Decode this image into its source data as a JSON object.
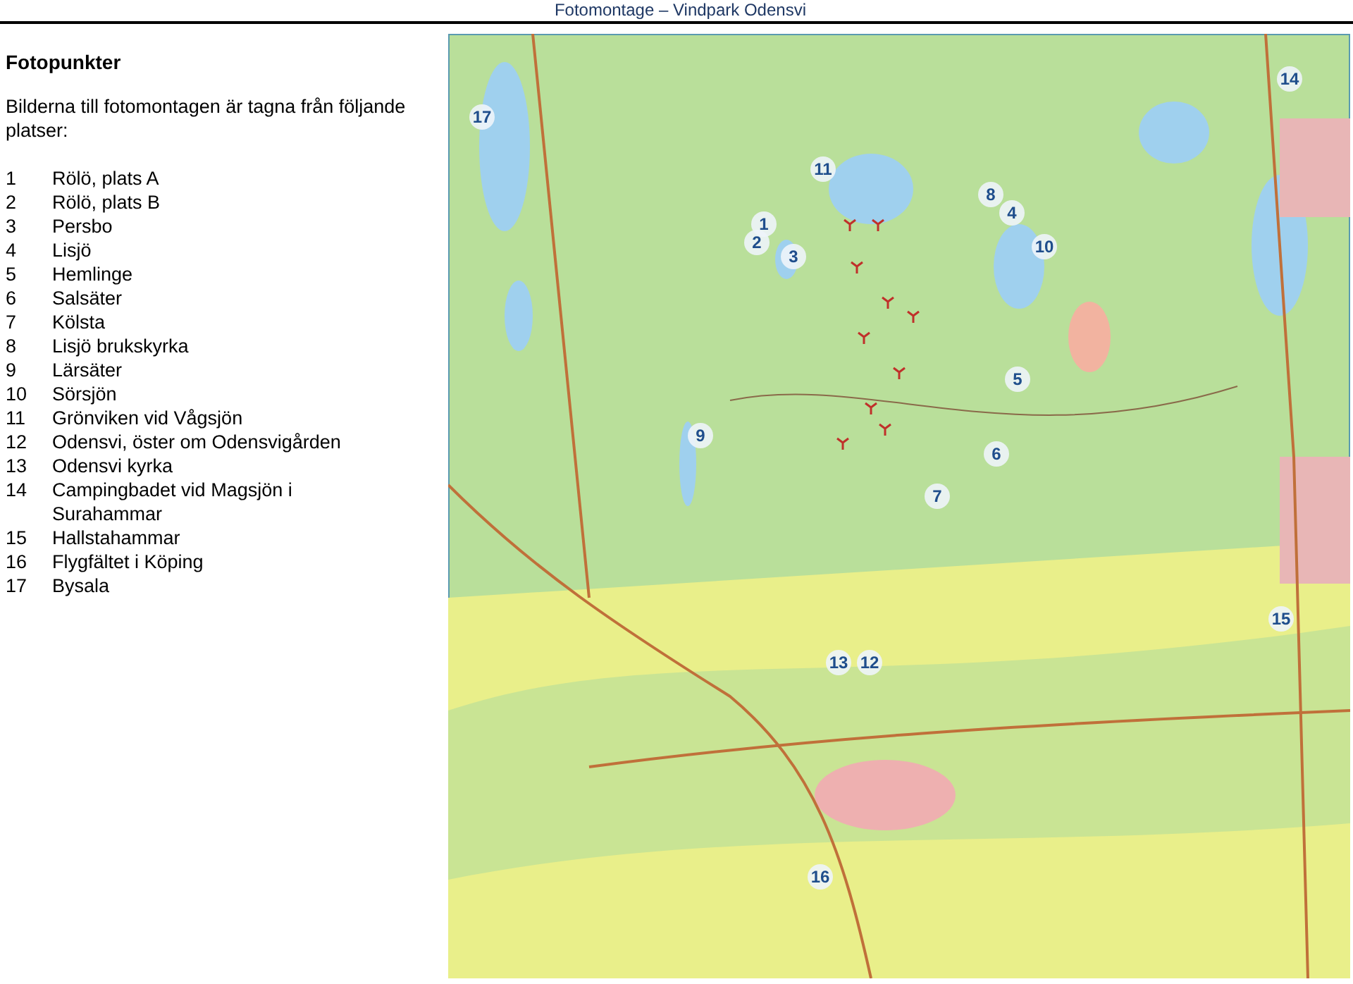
{
  "header": {
    "title": "Fotomontage – Vindpark Odensvi"
  },
  "sidebar": {
    "heading": "Fotopunkter",
    "intro": "Bilderna till fotomontagen är tagna från följande platser:",
    "points": [
      {
        "number": "1",
        "place": "Rölö, plats A"
      },
      {
        "number": "2",
        "place": "Rölö, plats B"
      },
      {
        "number": "3",
        "place": "Persbo"
      },
      {
        "number": "4",
        "place": "Lisjö"
      },
      {
        "number": "5",
        "place": "Hemlinge"
      },
      {
        "number": "6",
        "place": "Salsäter"
      },
      {
        "number": "7",
        "place": "Kölsta"
      },
      {
        "number": "8",
        "place": "Lisjö brukskyrka"
      },
      {
        "number": "9",
        "place": "Lärsäter"
      },
      {
        "number": "10",
        "place": "Sörsjön"
      },
      {
        "number": "11",
        "place": "Grönviken vid Vågsjön"
      },
      {
        "number": "12",
        "place": "Odensvi, öster om Odensvigården"
      },
      {
        "number": "13",
        "place": "Odensvi kyrka"
      },
      {
        "number": "14",
        "place": "Campingbadet vid Magsjön i Surahammar"
      },
      {
        "number": "15",
        "place": "Hallstahammar"
      },
      {
        "number": "16",
        "place": "Flygfältet i Köping"
      },
      {
        "number": "17",
        "place": "Bysala"
      }
    ]
  },
  "map": {
    "markers": [
      {
        "label": "1"
      },
      {
        "label": "2"
      },
      {
        "label": "3"
      },
      {
        "label": "4"
      },
      {
        "label": "5"
      },
      {
        "label": "6"
      },
      {
        "label": "7"
      },
      {
        "label": "8"
      },
      {
        "label": "9"
      },
      {
        "label": "10"
      },
      {
        "label": "11"
      },
      {
        "label": "12"
      },
      {
        "label": "13"
      },
      {
        "label": "14"
      },
      {
        "label": "15"
      },
      {
        "label": "16"
      },
      {
        "label": "17"
      }
    ]
  }
}
